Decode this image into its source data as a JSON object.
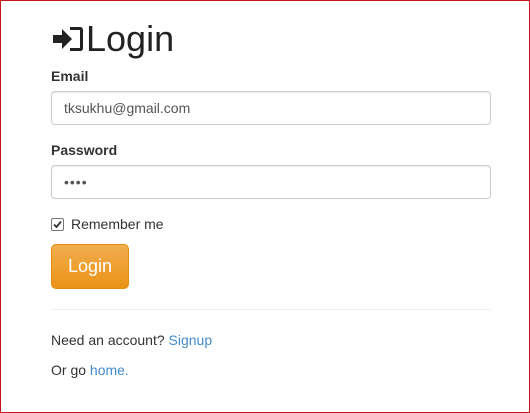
{
  "form": {
    "title": "Login",
    "title_icon": "sign-in-icon",
    "email_label": "Email",
    "email_value": "tksukhu@gmail.com",
    "password_label": "Password",
    "password_display": "••••",
    "remember_label": "Remember me",
    "remember_checked": true,
    "submit_label": "Login"
  },
  "footer": {
    "signup_prompt": "Need an account?",
    "signup_link": "Signup",
    "home_prompt": "Or go",
    "home_link": "home."
  },
  "colors": {
    "button_orange": "#f0ad4e",
    "link_blue": "#428bca",
    "frame_red": "#c8141e"
  }
}
